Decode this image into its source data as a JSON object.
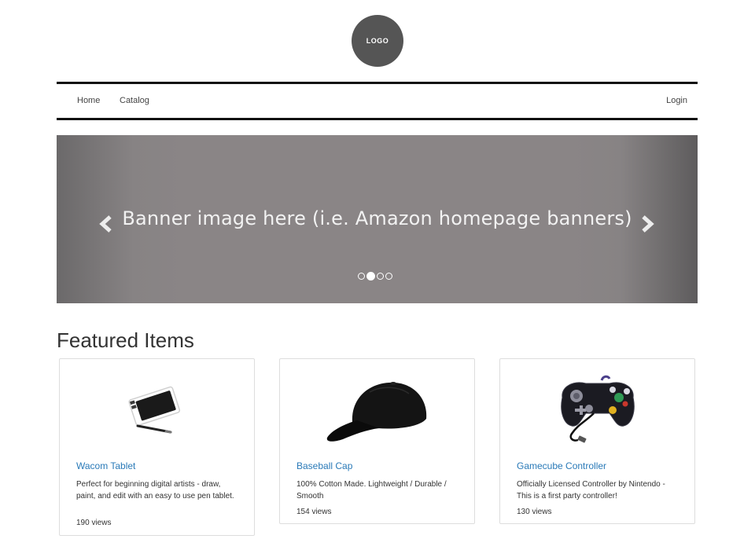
{
  "logo": {
    "text": "LOGO"
  },
  "nav": {
    "home": "Home",
    "catalog": "Catalog",
    "login": "Login"
  },
  "banner": {
    "text": "Banner image here (i.e. Amazon homepage banners)",
    "prev_icon": "chevron-left-icon",
    "next_icon": "chevron-right-icon",
    "slide_count": 4,
    "active_slide": 2
  },
  "featured": {
    "title": "Featured Items",
    "items": [
      {
        "title": "Wacom Tablet",
        "description": "Perfect for beginning digital artists - draw, paint, and edit with an easy to use pen tablet.",
        "views": "190 views"
      },
      {
        "title": "Baseball Cap",
        "description": "100% Cotton Made. Lightweight / Durable / Smooth",
        "views": "154 views"
      },
      {
        "title": "Gamecube Controller",
        "description": "Officially Licensed Controller by Nintendo - This is a first party controller!",
        "views": "130 views"
      }
    ]
  },
  "colors": {
    "link": "#2a7ab8",
    "logo_bg": "#555555",
    "banner_bg": "#8a8586"
  }
}
